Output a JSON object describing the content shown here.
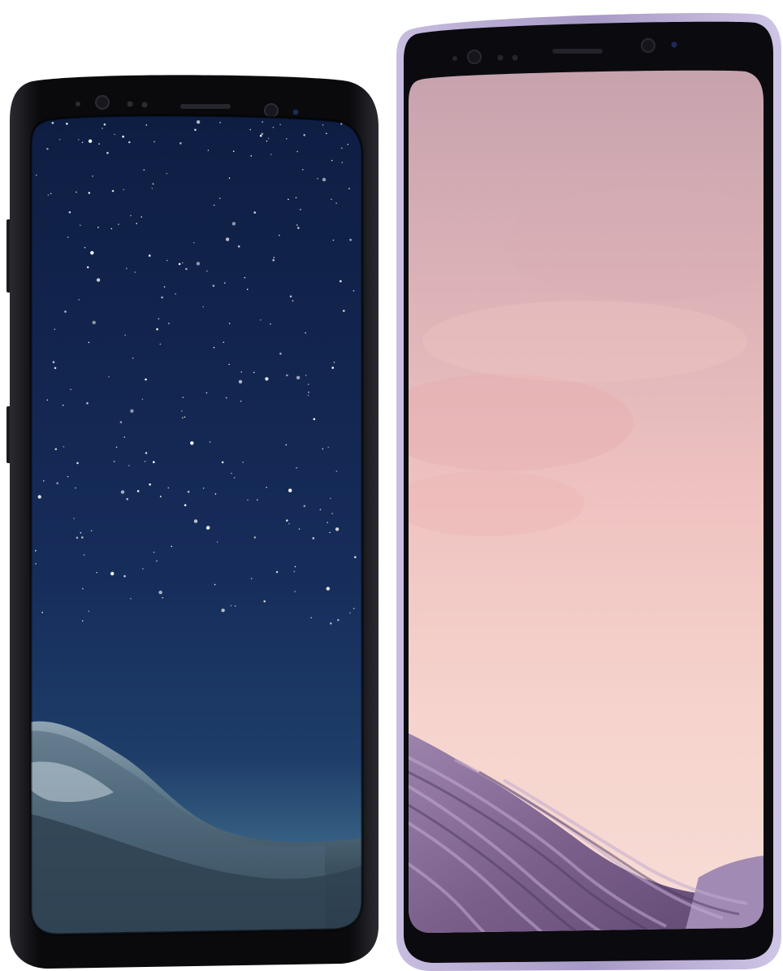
{
  "scene": {
    "background": "#ffffff",
    "phones": [
      {
        "id": "left-phone",
        "frame_color": "#0d0d10",
        "wallpaper": "night-sky-mountain",
        "sky_colors": [
          "#0f1f45",
          "#18305f",
          "#2a4c78"
        ],
        "mountain_colors": [
          "#5a7585",
          "#3f5869",
          "#22323f"
        ]
      },
      {
        "id": "right-phone",
        "frame_color": "#a79ac7",
        "bezel_color": "#0c0b10",
        "wallpaper": "pink-sky-lavender-hills",
        "sky_colors": [
          "#c9a3ad",
          "#f1c6c3",
          "#f6dcd4"
        ],
        "hill_colors": [
          "#8a6f9a",
          "#6f557f",
          "#a58db4"
        ]
      }
    ]
  }
}
